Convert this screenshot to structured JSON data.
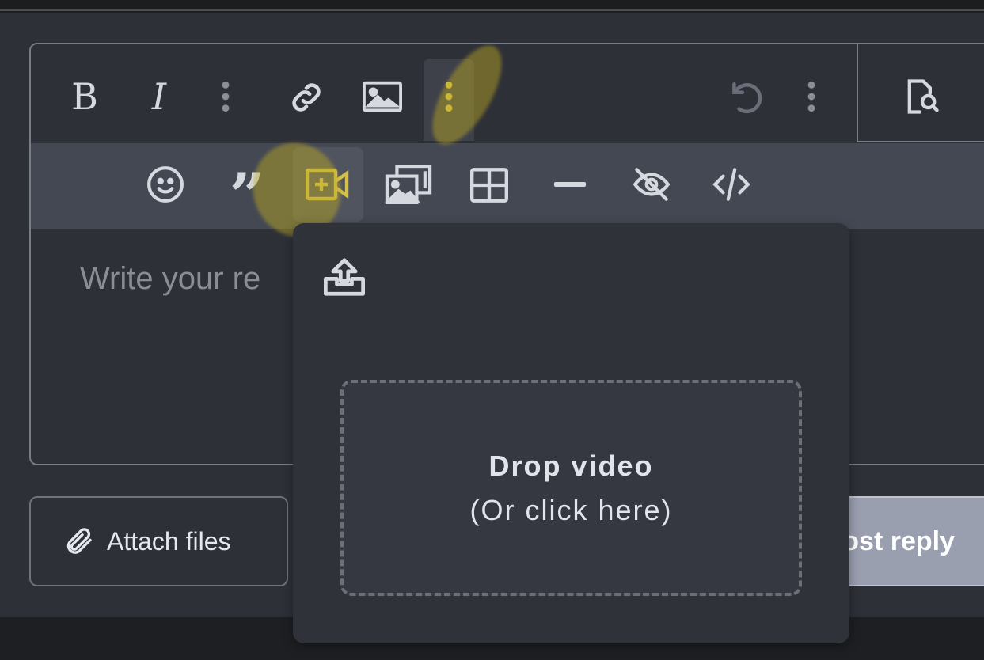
{
  "editor": {
    "placeholder": "Write your re",
    "toolbar_primary": [
      "bold-icon",
      "italic-icon",
      "more-vertical-icon",
      "link-icon",
      "image-icon",
      "more-vertical-icon",
      "undo-icon",
      "more-vertical-icon"
    ],
    "toolbar_secondary": [
      "emoji-icon",
      "quote-icon",
      "video-add-icon",
      "gallery-icon",
      "table-icon",
      "horizontal-rule-icon",
      "eye-off-icon",
      "code-icon"
    ],
    "preview_icon": "file-search-icon"
  },
  "popup": {
    "upload_icon": "upload-icon",
    "drop_title": "Drop video",
    "drop_subtitle": "(Or click here)"
  },
  "actions": {
    "attach_label": "Attach files",
    "post_label": "Post reply"
  },
  "colors": {
    "accent_highlight": "#d4c04a",
    "post_button": "#9a9fb0"
  }
}
